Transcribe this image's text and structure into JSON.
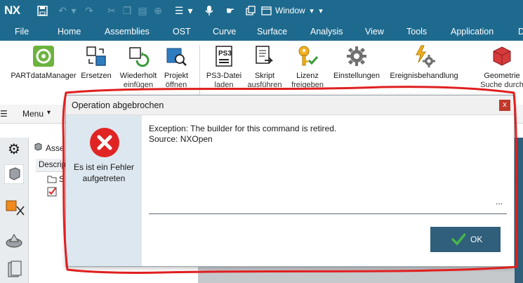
{
  "titlebar": {
    "logo": "NX",
    "window_label": "Window"
  },
  "menubar": {
    "items": [
      "File",
      "Home",
      "Assemblies",
      "OST",
      "Curve",
      "Surface",
      "Analysis",
      "View",
      "Tools",
      "Application",
      "D"
    ]
  },
  "ribbon": {
    "buttons": [
      {
        "line1": "PARTdataManager",
        "line2": ""
      },
      {
        "line1": "Ersetzen",
        "line2": ""
      },
      {
        "line1": "Wiederholt",
        "line2": "einfügen"
      },
      {
        "line1": "Projekt",
        "line2": "öffnen"
      },
      {
        "line1": "PS3-Datei",
        "line2": "laden"
      },
      {
        "line1": "Skript",
        "line2": "ausführen"
      },
      {
        "line1": "Lizenz",
        "line2": "freigeben"
      },
      {
        "line1": "Einstellungen",
        "line2": ""
      },
      {
        "line1": "Ereignisbehandlung",
        "line2": ""
      },
      {
        "line1": "Geometrie",
        "line2": "Suche durch"
      }
    ],
    "ps3_icon_text": "PS3"
  },
  "toolbar": {
    "menu_label": "Menu"
  },
  "navigator": {
    "header": "Asse",
    "column": "Descrip",
    "row1": "S"
  },
  "dialog": {
    "title": "Operation abgebrochen",
    "close_label": "x",
    "error_label": "Es ist ein Fehler aufgetreten",
    "message_line1": "Exception: The builder for this command is retired.",
    "message_line2": "Source: NXOpen",
    "more": "...",
    "ok_label": "OK"
  },
  "colors": {
    "accent": "#1e6a8e",
    "ok_button": "#2f5f7a",
    "error": "#e02424",
    "annotation": "#e01f1f"
  }
}
